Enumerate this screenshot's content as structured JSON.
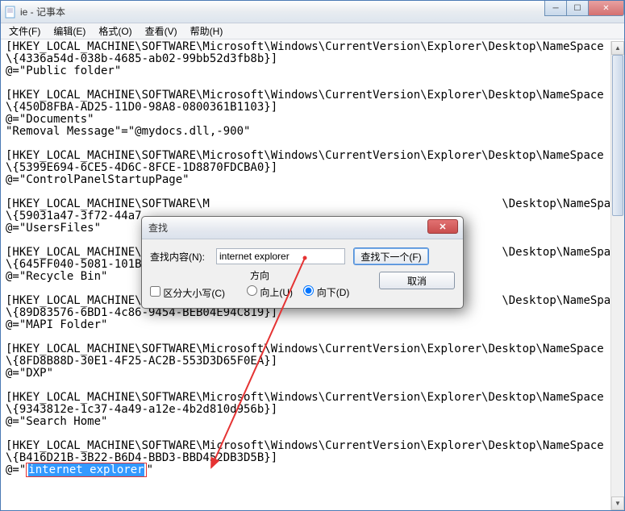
{
  "window": {
    "title": "ie - 记事本"
  },
  "menu": {
    "file": "文件(F)",
    "edit": "编辑(E)",
    "format": "格式(O)",
    "view": "查看(V)",
    "help": "帮助(H)"
  },
  "content": {
    "l1": "[HKEY_LOCAL_MACHINE\\SOFTWARE\\Microsoft\\Windows\\CurrentVersion\\Explorer\\Desktop\\NameSpace",
    "l2": "\\{4336a54d-038b-4685-ab02-99bb52d3fb8b}]",
    "l3": "@=\"Public folder\"",
    "l4": "",
    "l5": "[HKEY_LOCAL_MACHINE\\SOFTWARE\\Microsoft\\Windows\\CurrentVersion\\Explorer\\Desktop\\NameSpace",
    "l6": "\\{450D8FBA-AD25-11D0-98A8-0800361B1103}]",
    "l7": "@=\"Documents\"",
    "l8": "\"Removal Message\"=\"@mydocs.dll,-900\"",
    "l9": "",
    "l10": "[HKEY_LOCAL_MACHINE\\SOFTWARE\\Microsoft\\Windows\\CurrentVersion\\Explorer\\Desktop\\NameSpace",
    "l11": "\\{5399E694-6CE5-4D6C-8FCE-1D8870FDCBA0}]",
    "l12": "@=\"ControlPanelStartupPage\"",
    "l13": "",
    "l14a": "[HKEY_LOCAL_MACHINE\\SOFTWARE\\M",
    "l14b": "\\Desktop\\NameSpace",
    "l15": "\\{59031a47-3f72-44a7",
    "l16": "@=\"UsersFiles\"",
    "l17": "",
    "l18a": "[HKEY_LOCAL_MACHINE\\S",
    "l18b": "\\Desktop\\NameSpace",
    "l19": "\\{645FF040-5081-101B-",
    "l20": "@=\"Recycle Bin\"",
    "l21": "",
    "l22a": "[HKEY_LOCAL_MACHINE\\S",
    "l22b": "\\Desktop\\NameSpace",
    "l23": "\\{89D83576-6BD1-4c86-9454-BEB04E94C819}]",
    "l24": "@=\"MAPI Folder\"",
    "l25": "",
    "l26": "[HKEY_LOCAL_MACHINE\\SOFTWARE\\Microsoft\\Windows\\CurrentVersion\\Explorer\\Desktop\\NameSpace",
    "l27": "\\{8FD8B88D-30E1-4F25-AC2B-553D3D65F0EA}]",
    "l28": "@=\"DXP\"",
    "l29": "",
    "l30": "[HKEY_LOCAL_MACHINE\\SOFTWARE\\Microsoft\\Windows\\CurrentVersion\\Explorer\\Desktop\\NameSpace",
    "l31": "\\{9343812e-1c37-4a49-a12e-4b2d810d956b}]",
    "l32": "@=\"Search Home\"",
    "l33": "",
    "l34": "[HKEY_LOCAL_MACHINE\\SOFTWARE\\Microsoft\\Windows\\CurrentVersion\\Explorer\\Desktop\\NameSpace",
    "l35": "\\{B416D21B-3B22-B6D4-BBD3-BBD452DB3D5B}]",
    "l36a": "@=\"",
    "l36b": "internet explorer",
    "l36c": "\""
  },
  "dialog": {
    "title": "查找",
    "label_find": "查找内容(N):",
    "input_value": "internet explorer",
    "btn_findnext": "查找下一个(F)",
    "btn_cancel": "取消",
    "group_direction": "方向",
    "radio_up": "向上(U)",
    "radio_down": "向下(D)",
    "check_case": "区分大小写(C)"
  }
}
